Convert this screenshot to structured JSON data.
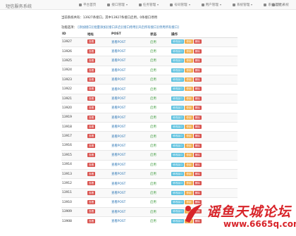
{
  "app": {
    "brand": "短信服务系统",
    "logout": "退出系统"
  },
  "nav": [
    {
      "label": "平台首页",
      "dropdown": false
    },
    {
      "label": "接口管理",
      "dropdown": true
    },
    {
      "label": "任务管理",
      "dropdown": true
    },
    {
      "label": "号码管理",
      "dropdown": true
    },
    {
      "label": "用户管理",
      "dropdown": true
    },
    {
      "label": "系统管理",
      "dropdown": true
    },
    {
      "label": "系统选项",
      "dropdown": true
    }
  ],
  "summary": "当前系统共有：13927条接口，其中13927条接口启用，0条接口停用",
  "functions": {
    "label": "功能选项：",
    "links": [
      "[添加接口]",
      "[批量添加]",
      "[接口开启]",
      "[接口停用]",
      "[开启所有接口]",
      "[停用所有接口]"
    ]
  },
  "table": {
    "headers": [
      "ID",
      "地址",
      "POST",
      "状态",
      "操作"
    ],
    "view_label": "查看",
    "post_label": "查看POST",
    "status_label": "启用",
    "edit_label": "修改接口",
    "disable_label": "停用",
    "delete_label": "删除",
    "ids": [
      "13927",
      "13926",
      "13925",
      "13924",
      "13923",
      "13922",
      "13921",
      "13920",
      "13919",
      "13918",
      "13917",
      "13916",
      "13915",
      "13914",
      "13913",
      "13912",
      "13911",
      "13910",
      "13909",
      "13908"
    ]
  },
  "watermark": {
    "text": "谣鱼天城论坛",
    "url": "www.6665q.com"
  },
  "colors": {
    "danger": "#d9534f",
    "info": "#5bc0de",
    "warning": "#f0ad4e",
    "link": "#337ab7",
    "success": "#3c9a3c"
  }
}
